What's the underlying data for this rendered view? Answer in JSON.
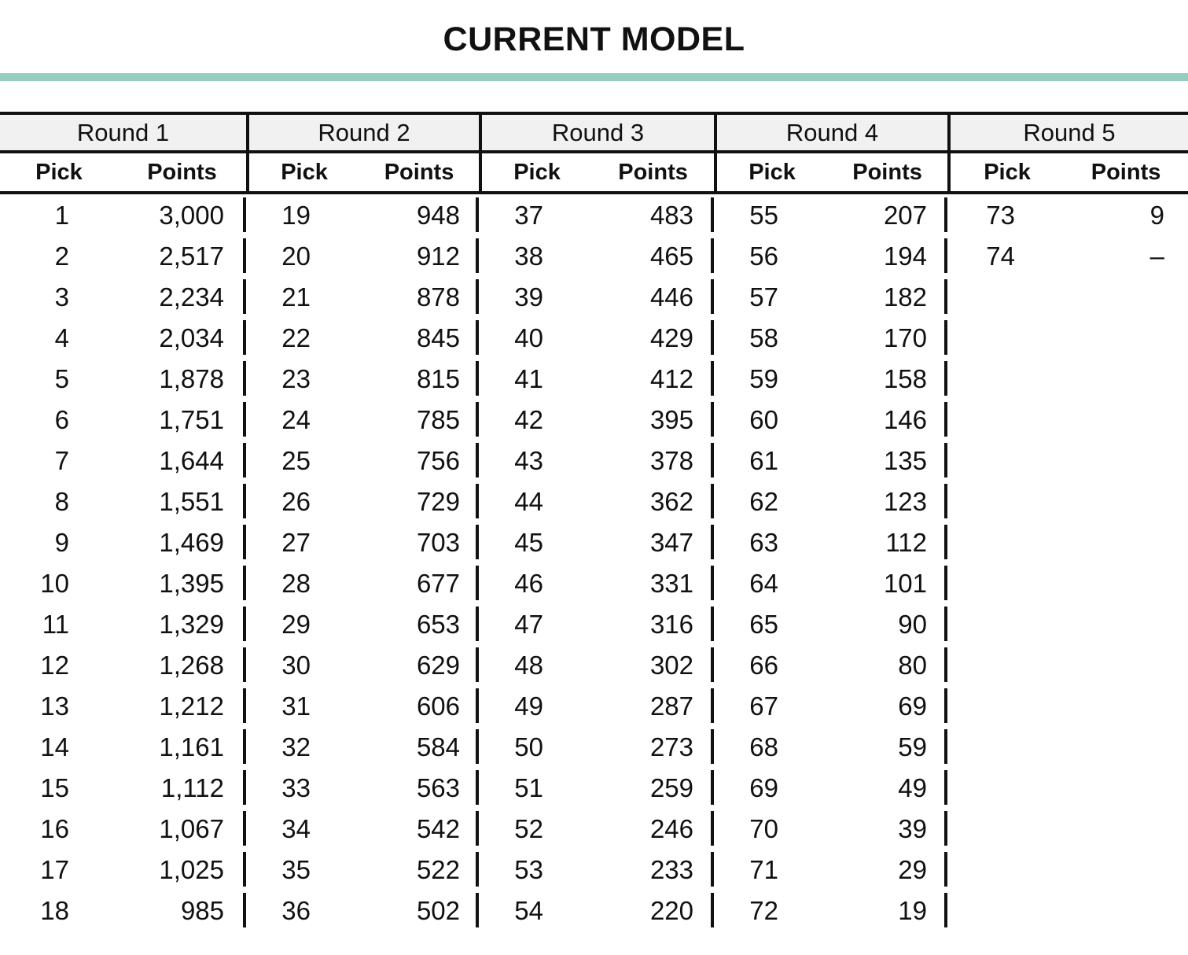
{
  "title": "CURRENT MODEL",
  "accent_color": "#93cec0",
  "header_background": "#f1f1f1",
  "rule_color": "#111111",
  "columns": {
    "pick_label": "Pick",
    "points_label": "Points"
  },
  "table": {
    "rounds": [
      {
        "label": "Round 1",
        "rows": [
          {
            "pick": "1",
            "points": "3,000"
          },
          {
            "pick": "2",
            "points": "2,517"
          },
          {
            "pick": "3",
            "points": "2,234"
          },
          {
            "pick": "4",
            "points": "2,034"
          },
          {
            "pick": "5",
            "points": "1,878"
          },
          {
            "pick": "6",
            "points": "1,751"
          },
          {
            "pick": "7",
            "points": "1,644"
          },
          {
            "pick": "8",
            "points": "1,551"
          },
          {
            "pick": "9",
            "points": "1,469"
          },
          {
            "pick": "10",
            "points": "1,395"
          },
          {
            "pick": "11",
            "points": "1,329"
          },
          {
            "pick": "12",
            "points": "1,268"
          },
          {
            "pick": "13",
            "points": "1,212"
          },
          {
            "pick": "14",
            "points": "1,161"
          },
          {
            "pick": "15",
            "points": "1,112"
          },
          {
            "pick": "16",
            "points": "1,067"
          },
          {
            "pick": "17",
            "points": "1,025"
          },
          {
            "pick": "18",
            "points": "985"
          }
        ]
      },
      {
        "label": "Round 2",
        "rows": [
          {
            "pick": "19",
            "points": "948"
          },
          {
            "pick": "20",
            "points": "912"
          },
          {
            "pick": "21",
            "points": "878"
          },
          {
            "pick": "22",
            "points": "845"
          },
          {
            "pick": "23",
            "points": "815"
          },
          {
            "pick": "24",
            "points": "785"
          },
          {
            "pick": "25",
            "points": "756"
          },
          {
            "pick": "26",
            "points": "729"
          },
          {
            "pick": "27",
            "points": "703"
          },
          {
            "pick": "28",
            "points": "677"
          },
          {
            "pick": "29",
            "points": "653"
          },
          {
            "pick": "30",
            "points": "629"
          },
          {
            "pick": "31",
            "points": "606"
          },
          {
            "pick": "32",
            "points": "584"
          },
          {
            "pick": "33",
            "points": "563"
          },
          {
            "pick": "34",
            "points": "542"
          },
          {
            "pick": "35",
            "points": "522"
          },
          {
            "pick": "36",
            "points": "502"
          }
        ]
      },
      {
        "label": "Round 3",
        "rows": [
          {
            "pick": "37",
            "points": "483"
          },
          {
            "pick": "38",
            "points": "465"
          },
          {
            "pick": "39",
            "points": "446"
          },
          {
            "pick": "40",
            "points": "429"
          },
          {
            "pick": "41",
            "points": "412"
          },
          {
            "pick": "42",
            "points": "395"
          },
          {
            "pick": "43",
            "points": "378"
          },
          {
            "pick": "44",
            "points": "362"
          },
          {
            "pick": "45",
            "points": "347"
          },
          {
            "pick": "46",
            "points": "331"
          },
          {
            "pick": "47",
            "points": "316"
          },
          {
            "pick": "48",
            "points": "302"
          },
          {
            "pick": "49",
            "points": "287"
          },
          {
            "pick": "50",
            "points": "273"
          },
          {
            "pick": "51",
            "points": "259"
          },
          {
            "pick": "52",
            "points": "246"
          },
          {
            "pick": "53",
            "points": "233"
          },
          {
            "pick": "54",
            "points": "220"
          }
        ]
      },
      {
        "label": "Round 4",
        "rows": [
          {
            "pick": "55",
            "points": "207"
          },
          {
            "pick": "56",
            "points": "194"
          },
          {
            "pick": "57",
            "points": "182"
          },
          {
            "pick": "58",
            "points": "170"
          },
          {
            "pick": "59",
            "points": "158"
          },
          {
            "pick": "60",
            "points": "146"
          },
          {
            "pick": "61",
            "points": "135"
          },
          {
            "pick": "62",
            "points": "123"
          },
          {
            "pick": "63",
            "points": "112"
          },
          {
            "pick": "64",
            "points": "101"
          },
          {
            "pick": "65",
            "points": "90"
          },
          {
            "pick": "66",
            "points": "80"
          },
          {
            "pick": "67",
            "points": "69"
          },
          {
            "pick": "68",
            "points": "59"
          },
          {
            "pick": "69",
            "points": "49"
          },
          {
            "pick": "70",
            "points": "39"
          },
          {
            "pick": "71",
            "points": "29"
          },
          {
            "pick": "72",
            "points": "19"
          }
        ]
      },
      {
        "label": "Round 5",
        "rows": [
          {
            "pick": "73",
            "points": "9"
          },
          {
            "pick": "74",
            "points": "–"
          }
        ]
      }
    ]
  }
}
